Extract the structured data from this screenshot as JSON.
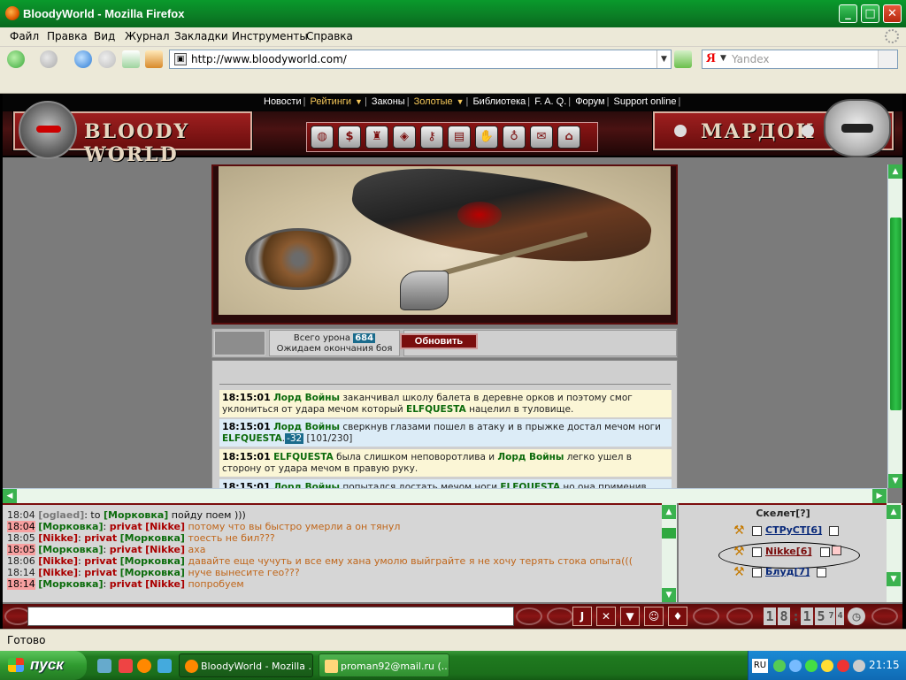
{
  "window": {
    "title": "BloodyWorld - Mozilla Firefox",
    "minimize": "_",
    "maximize": "□",
    "close": "✕"
  },
  "menu": [
    "Файл",
    "Правка",
    "Вид",
    "Журнал",
    "Закладки",
    "Инструменты",
    "Справка"
  ],
  "nav": {
    "url": "http://www.bloodyworld.com/",
    "search_placeholder": "Yandex",
    "search_engine": "Я"
  },
  "site_nav": {
    "items": [
      "Новости",
      "Рейтинги",
      "Законы",
      "Золотые",
      "Библиотека",
      "F. A. Q.",
      "Форум",
      "Support online"
    ]
  },
  "header": {
    "logo_left": "BLOODY WORLD",
    "logo_right": "МАРДОК"
  },
  "icons": [
    "bag-icon",
    "money-bag-icon",
    "armor-icon",
    "shield-crest-icon",
    "key-icon",
    "pass-icon",
    "glove-icon",
    "potion-icon",
    "mail-icon",
    "gate-icon"
  ],
  "battle": {
    "damage_label": "Всего урона",
    "damage_value": "684",
    "waiting_text": "Ожидаем окончания боя",
    "refresh_label": "Обновить"
  },
  "log": [
    {
      "time": "18:15:01",
      "actor": "Лорд Войны",
      "text1": "заканчивал школу балета в деревне орков и поэтому смог уклониться от удара мечом который",
      "target": "ELFQUESTA",
      "text2": "нацелил в туловище."
    },
    {
      "time": "18:15:01",
      "actor": "Лорд Войны",
      "text1": "сверкнув глазами пошел в атаку и в прыжке достал мечом ноги",
      "target": "ELFQUESTA",
      "hit": "-32",
      "hp": "[101/230]"
    },
    {
      "time": "18:15:01",
      "actor": "ELFQUESTA",
      "text1": "была слишком неповоротлива и",
      "target": "Лорд Войны",
      "text2": "легко ушел в сторону от удара мечом в правую руку."
    },
    {
      "time": "18:15:01",
      "actor": "Лорд Войны",
      "text1": "попытался достать мечом ноги",
      "target": "ELFQUESTA",
      "text2": "но она применив маневр ухода"
    }
  ],
  "chat": [
    {
      "time": "18:04",
      "hl": false,
      "from": "[oglaed]",
      "from_style": "gray",
      "kind": "to",
      "to": "[Морковка]",
      "to_style": "green",
      "msg": "пойду поем )))",
      "msg_style": "msgb"
    },
    {
      "time": "18:04",
      "hl": true,
      "from": "[Морковка]",
      "from_style": "green",
      "kind": "privat",
      "to": "[Nikke]",
      "to_style": "red",
      "msg": "потому что вы быстро умерли а он тянул",
      "msg_style": "msg"
    },
    {
      "time": "18:05",
      "hl": false,
      "from": "[Nikke]",
      "from_style": "red",
      "kind": "privat",
      "to": "[Морковка]",
      "to_style": "green",
      "msg": "тоесть не бил???",
      "msg_style": "msg"
    },
    {
      "time": "18:05",
      "hl": true,
      "from": "[Морковка]",
      "from_style": "green",
      "kind": "privat",
      "to": "[Nikke]",
      "to_style": "red",
      "msg": "аха",
      "msg_style": "msg"
    },
    {
      "time": "18:06",
      "hl": false,
      "from": "[Nikke]",
      "from_style": "red",
      "kind": "privat",
      "to": "[Морковка]",
      "to_style": "green",
      "msg": "давайте еще чучуть и все ему хана умолю выйграйте я не хочу терять стока опыта(((",
      "msg_style": "msg"
    },
    {
      "time": "18:14",
      "hl": false,
      "from": "[Nikke]",
      "from_style": "red",
      "kind": "privat",
      "to": "[Морковка]",
      "to_style": "green",
      "msg": "нуче вынесите гео???",
      "msg_style": "msg"
    },
    {
      "time": "18:14",
      "hl": true,
      "from": "[Морковка]",
      "from_style": "green",
      "kind": "privat",
      "to": "[Nikke]",
      "to_style": "red",
      "msg": "попробуем",
      "msg_style": "msg"
    }
  ],
  "online": {
    "header": "Скелет[?]",
    "users": [
      {
        "name": "СТРуСТ[6]",
        "self": false
      },
      {
        "name": "Nikke[6]",
        "self": true
      },
      {
        "name": "Блуд[7]",
        "self": false
      }
    ]
  },
  "controls": {
    "buttons": [
      "J",
      "✕",
      "▼",
      "☺",
      "♦"
    ],
    "clock_digits": [
      "1",
      "8",
      "1",
      "5",
      "7",
      "4"
    ],
    "clock_sep": ":"
  },
  "status": {
    "text": "Готово"
  },
  "taskbar": {
    "start": "пуск",
    "tasks": [
      {
        "label": "BloodyWorld - Mozilla ...",
        "active": true
      },
      {
        "label": "proman92@mail.ru (...",
        "active": false
      }
    ],
    "lang": "RU",
    "time": "21:15"
  }
}
